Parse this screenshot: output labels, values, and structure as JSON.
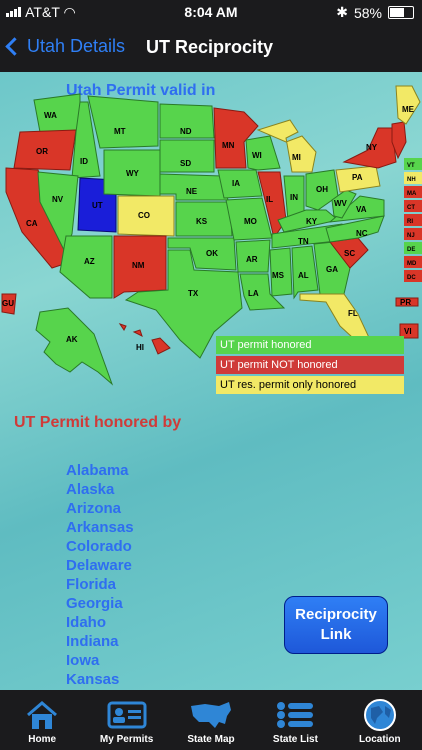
{
  "status_bar": {
    "carrier": "AT&T",
    "time": "8:04 AM",
    "battery": "58%"
  },
  "nav": {
    "back_label": "Utah Details",
    "title": "UT Reciprocity"
  },
  "map": {
    "title": "Utah Permit valid in",
    "colors": {
      "honored": "#57d44c",
      "not_honored": "#d93628",
      "resident_only": "#f2e966",
      "home": "#1a1ed9"
    },
    "state_labels": [
      {
        "abbr": "WA",
        "s": "honored"
      },
      {
        "abbr": "OR",
        "s": "not_honored"
      },
      {
        "abbr": "CA",
        "s": "not_honored"
      },
      {
        "abbr": "ID",
        "s": "honored"
      },
      {
        "abbr": "NV",
        "s": "honored"
      },
      {
        "abbr": "UT",
        "s": "home"
      },
      {
        "abbr": "MT",
        "s": "honored"
      },
      {
        "abbr": "WY",
        "s": "honored"
      },
      {
        "abbr": "CO",
        "s": "resident_only"
      },
      {
        "abbr": "AZ",
        "s": "honored"
      },
      {
        "abbr": "NM",
        "s": "not_honored"
      },
      {
        "abbr": "ND",
        "s": "honored"
      },
      {
        "abbr": "SD",
        "s": "honored"
      },
      {
        "abbr": "NE",
        "s": "honored"
      },
      {
        "abbr": "KS",
        "s": "honored"
      },
      {
        "abbr": "OK",
        "s": "honored"
      },
      {
        "abbr": "TX",
        "s": "honored"
      },
      {
        "abbr": "MN",
        "s": "not_honored"
      },
      {
        "abbr": "IA",
        "s": "honored"
      },
      {
        "abbr": "MO",
        "s": "honored"
      },
      {
        "abbr": "AR",
        "s": "honored"
      },
      {
        "abbr": "LA",
        "s": "honored"
      },
      {
        "abbr": "WI",
        "s": "honored"
      },
      {
        "abbr": "IL",
        "s": "not_honored"
      },
      {
        "abbr": "MI",
        "s": "resident_only"
      },
      {
        "abbr": "IN",
        "s": "honored"
      },
      {
        "abbr": "OH",
        "s": "honored"
      },
      {
        "abbr": "KY",
        "s": "honored"
      },
      {
        "abbr": "TN",
        "s": "honored"
      },
      {
        "abbr": "MS",
        "s": "honored"
      },
      {
        "abbr": "AL",
        "s": "honored"
      },
      {
        "abbr": "GA",
        "s": "honored"
      },
      {
        "abbr": "FL",
        "s": "resident_only"
      },
      {
        "abbr": "SC",
        "s": "not_honored"
      },
      {
        "abbr": "NC",
        "s": "honored"
      },
      {
        "abbr": "VA",
        "s": "honored"
      },
      {
        "abbr": "WV",
        "s": "honored"
      },
      {
        "abbr": "PA",
        "s": "resident_only"
      },
      {
        "abbr": "NY",
        "s": "not_honored"
      },
      {
        "abbr": "ME",
        "s": "resident_only"
      },
      {
        "abbr": "AK",
        "s": "honored"
      },
      {
        "abbr": "HI",
        "s": "not_honored"
      },
      {
        "abbr": "GU",
        "s": "not_honored"
      },
      {
        "abbr": "PR",
        "s": "not_honored"
      },
      {
        "abbr": "VI",
        "s": "not_honored"
      }
    ],
    "east_boxes": [
      {
        "abbr": "VT",
        "s": "honored"
      },
      {
        "abbr": "NH",
        "s": "resident_only"
      },
      {
        "abbr": "MA",
        "s": "not_honored"
      },
      {
        "abbr": "CT",
        "s": "not_honored"
      },
      {
        "abbr": "RI",
        "s": "not_honored"
      },
      {
        "abbr": "NJ",
        "s": "not_honored"
      },
      {
        "abbr": "DE",
        "s": "honored"
      },
      {
        "abbr": "MD",
        "s": "not_honored"
      },
      {
        "abbr": "DC",
        "s": "not_honored"
      }
    ]
  },
  "legend": {
    "honored": "UT permit honored",
    "not_honored": "UT permit NOT honored",
    "resident_only": "UT res. permit only honored"
  },
  "honored_by": {
    "title": "UT Permit honored by",
    "states": [
      "Alabama",
      "Alaska",
      "Arizona",
      "Arkansas",
      "Colorado",
      "Delaware",
      "Florida",
      "Georgia",
      "Idaho",
      "Indiana",
      "Iowa",
      "Kansas"
    ]
  },
  "reciprocity_button": {
    "line1": "Reciprocity",
    "line2": "Link"
  },
  "tabs": [
    {
      "label": "Home",
      "icon": "home-icon"
    },
    {
      "label": "My Permits",
      "icon": "id-card-icon"
    },
    {
      "label": "State Map",
      "icon": "us-map-icon"
    },
    {
      "label": "State List",
      "icon": "list-icon"
    },
    {
      "label": "Location",
      "icon": "globe-icon"
    }
  ]
}
